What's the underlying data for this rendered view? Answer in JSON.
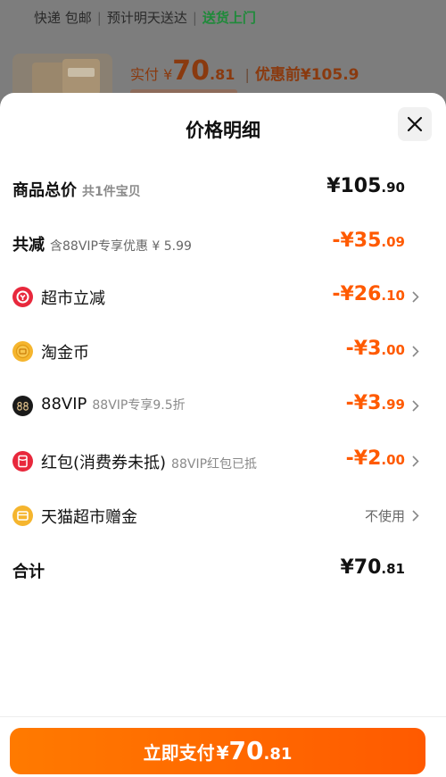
{
  "background": {
    "shipping": {
      "express": "快递 包邮",
      "eta": "预计明天送达",
      "delivery": "送货上门"
    },
    "price": {
      "label": "实付",
      "currency": "¥",
      "integer": "70",
      "decimal": ".81",
      "before_label": "优惠前",
      "before_value": "¥105.9"
    }
  },
  "sheet": {
    "title": "价格明细",
    "close_icon": "close-icon",
    "rows": {
      "subtotal": {
        "label": "商品总价",
        "note": "共1件宝贝",
        "amount_int": "¥105",
        "amount_dec": ".90"
      },
      "total_reduced": {
        "label": "共减",
        "note": "含88VIP专享优惠 ¥ 5.99",
        "amount_int": "-¥35",
        "amount_dec": ".09"
      },
      "supermarket": {
        "label": "超市立减",
        "amount_int": "-¥26",
        "amount_dec": ".10",
        "icon": "supermarket-discount-icon"
      },
      "taojinbi": {
        "label": "淘金币",
        "amount_int": "-¥3",
        "amount_dec": ".00",
        "icon": "coin-icon"
      },
      "vip": {
        "label": "88VIP",
        "note": "88VIP专享9.5折",
        "amount_int": "-¥3",
        "amount_dec": ".99",
        "icon": "88vip-icon"
      },
      "redpacket": {
        "label": "红包(消费券未抵)",
        "note": "88VIP红包已抵",
        "amount_int": "-¥2",
        "amount_dec": ".00",
        "icon": "red-packet-icon"
      },
      "giftcard": {
        "label": "天猫超市赠金",
        "value": "不使用",
        "icon": "gift-card-icon"
      },
      "total": {
        "label": "合计",
        "amount_int": "¥70",
        "amount_dec": ".81"
      }
    },
    "pay_button": {
      "label": "立即支付",
      "currency": "¥",
      "integer": "70",
      "decimal": ".81"
    }
  },
  "colors": {
    "accent": "#ff5a00",
    "green": "#1f8a3a",
    "text": "#111111",
    "muted": "#666666"
  }
}
